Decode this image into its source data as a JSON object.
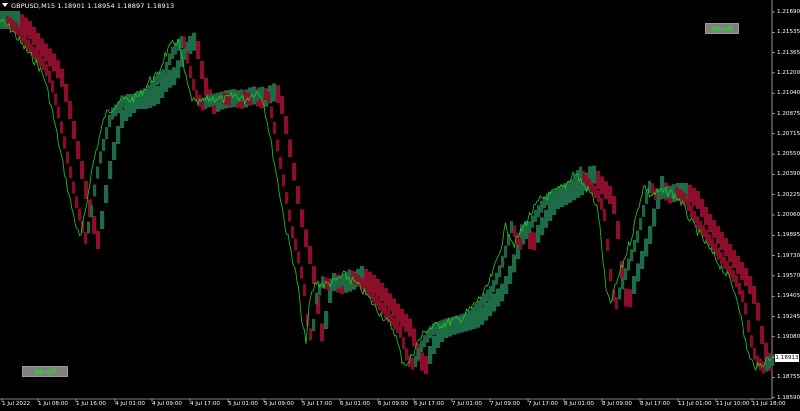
{
  "header": {
    "text": "GBPUSD,M15  1.18901 1.18954 1.18897 1.18913"
  },
  "buttons": {
    "top_label": "HA-off",
    "bottom_label": "HA-off"
  },
  "colors": {
    "background": "#000000",
    "bull_band": "#1e6b47",
    "bear_band": "#8b0f2a",
    "price_line": "#22cc22",
    "axis_text": "#ffffff"
  },
  "axis": {
    "y_ticks": [
      "1.21690",
      "1.21535",
      "1.21365",
      "1.21200",
      "1.21040",
      "1.20875",
      "1.20715",
      "1.20550",
      "1.20390",
      "1.20225",
      "1.20060",
      "1.19895",
      "1.19730",
      "1.19570",
      "1.19405",
      "1.19245",
      "1.19080",
      "1.18913",
      "1.18755",
      "1.18590"
    ],
    "current_price": "1.18913",
    "x_ticks": [
      "1 Jul 2022",
      "1 Jul 08:00",
      "1 Jul 16:00",
      "4 Jul 01:00",
      "4 Jul 09:00",
      "4 Jul 17:00",
      "5 Jul 01:00",
      "5 Jul 09:00",
      "5 Jul 17:00",
      "6 Jul 01:00",
      "6 Jul 09:00",
      "6 Jul 17:00",
      "7 Jul 01:00",
      "7 Jul 09:00",
      "7 Jul 17:00",
      "8 Jul 01:00",
      "8 Jul 09:00",
      "8 Jul 17:00",
      "11 Jul 01:00",
      "11 Jul 10:00",
      "11 Jul 18:00"
    ]
  }
}
